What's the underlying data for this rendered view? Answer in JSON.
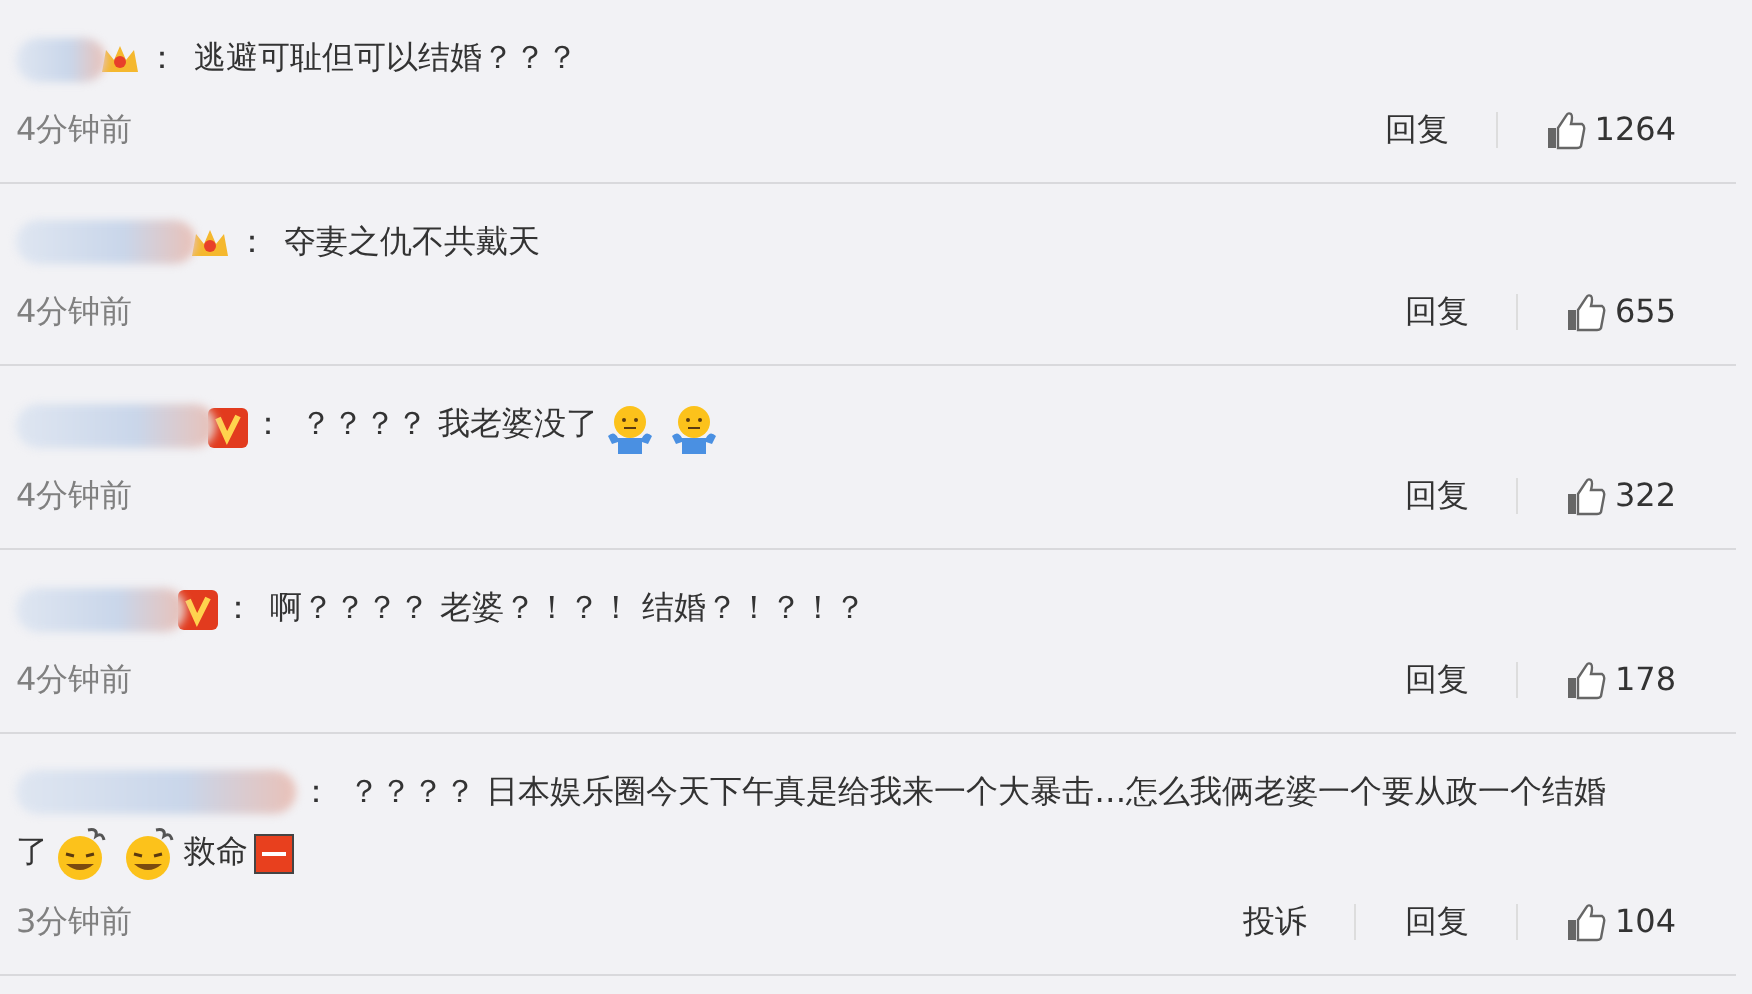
{
  "comments": [
    {
      "badge": {
        "kind": "crown"
      },
      "colon": "：",
      "lines": [
        [
          {
            "kind": "text",
            "text": "逃避可耻但可以结婚？？？"
          }
        ]
      ],
      "time": "4分钟前",
      "actions": [
        {
          "label": "回复"
        }
      ],
      "likes": "1264"
    },
    {
      "badge": {
        "kind": "crown"
      },
      "colon": "：",
      "lines": [
        [
          {
            "kind": "text",
            "text": "夺妻之仇不共戴天"
          }
        ]
      ],
      "time": "4分钟前",
      "actions": [
        {
          "label": "回复"
        }
      ],
      "likes": "655"
    },
    {
      "badge": {
        "kind": "v"
      },
      "colon": "：",
      "lines": [
        [
          {
            "kind": "text",
            "text": "？？？？ 我老婆没了"
          },
          {
            "kind": "shrug"
          },
          {
            "kind": "shrug"
          }
        ]
      ],
      "time": "4分钟前",
      "actions": [
        {
          "label": "回复"
        }
      ],
      "likes": "322"
    },
    {
      "badge": {
        "kind": "v"
      },
      "colon": "：",
      "lines": [
        [
          {
            "kind": "text",
            "text": "啊？？？？ 老婆？！？！ 结婚？！？！？"
          }
        ]
      ],
      "time": "4分钟前",
      "actions": [
        {
          "label": "回复"
        }
      ],
      "likes": "178"
    },
    {
      "colon": "：",
      "lines": [
        [
          {
            "kind": "text",
            "text": "？？？？ 日本娱乐圈今天下午真是给我来一个大暴击…怎么我俩老婆一个要从政一个结婚"
          }
        ],
        [
          {
            "kind": "text",
            "text": "了"
          },
          {
            "kind": "dizzy"
          },
          {
            "kind": "dizzy"
          },
          {
            "kind": "text",
            "text": "救命"
          },
          {
            "kind": "sos"
          }
        ]
      ],
      "time": "3分钟前",
      "actions": [
        {
          "label": "投诉"
        },
        {
          "label": "回复"
        }
      ],
      "likes": "104"
    }
  ]
}
